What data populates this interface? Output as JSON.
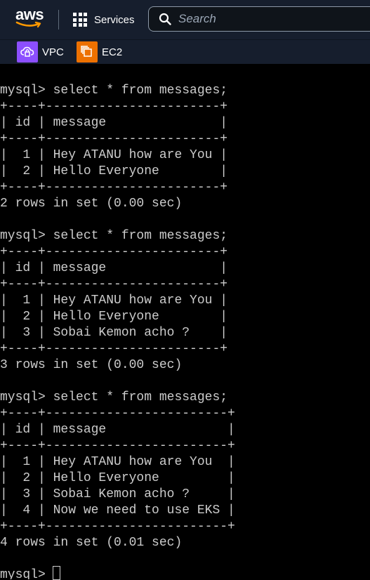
{
  "header": {
    "logo_text": "aws",
    "services_label": "Services",
    "search_placeholder": "Search"
  },
  "favorites": [
    {
      "label": "VPC",
      "icon": "vpc-icon",
      "color": "#8c4fff"
    },
    {
      "label": "EC2",
      "icon": "ec2-icon",
      "color": "#ed7100"
    }
  ],
  "terminal": {
    "background": "#000000",
    "text_color": "#cccccc",
    "text": "mysql> select * from messages;\n+----+-----------------------+\n| id | message               |\n+----+-----------------------+\n|  1 | Hey ATANU how are You |\n|  2 | Hello Everyone        |\n+----+-----------------------+\n2 rows in set (0.00 sec)\n\nmysql> select * from messages;\n+----+-----------------------+\n| id | message               |\n+----+-----------------------+\n|  1 | Hey ATANU how are You |\n|  2 | Hello Everyone        |\n|  3 | Sobai Kemon acho ?    |\n+----+-----------------------+\n3 rows in set (0.00 sec)\n\nmysql> select * from messages;\n+----+------------------------+\n| id | message                |\n+----+------------------------+\n|  1 | Hey ATANU how are You  |\n|  2 | Hello Everyone         |\n|  3 | Sobai Kemon acho ?     |\n|  4 | Now we need to use EKS |\n+----+------------------------+\n4 rows in set (0.01 sec)\n\nmysql> "
  }
}
